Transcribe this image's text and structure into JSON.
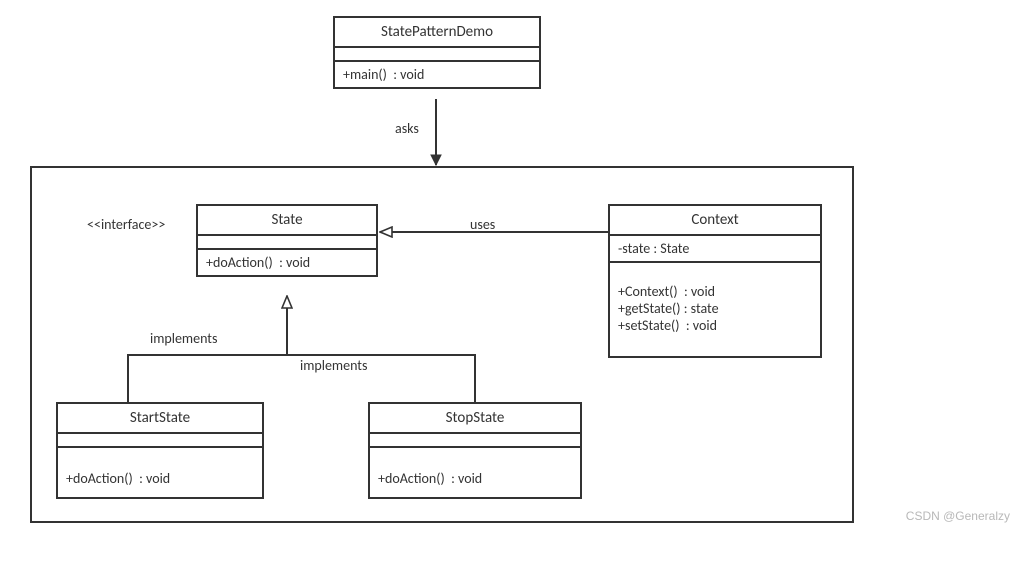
{
  "classes": {
    "demo": {
      "name": "StatePatternDemo",
      "methods": "+main()  : void"
    },
    "state": {
      "name": "State",
      "methods": "+doAction()  : void"
    },
    "context": {
      "name": "Context",
      "attributes": "-state : State",
      "methods": "+Context()  : void\n+getState() : state\n+setState()  : void"
    },
    "start": {
      "name": "StartState",
      "methods": "+doAction()  : void"
    },
    "stop": {
      "name": "StopState",
      "methods": "+doAction()  : void"
    }
  },
  "labels": {
    "interface": "<<interface>>",
    "asks": "asks",
    "uses": "uses",
    "implements_left": "implements",
    "implements_right": "implements"
  },
  "watermark": "CSDN @Generalzy"
}
